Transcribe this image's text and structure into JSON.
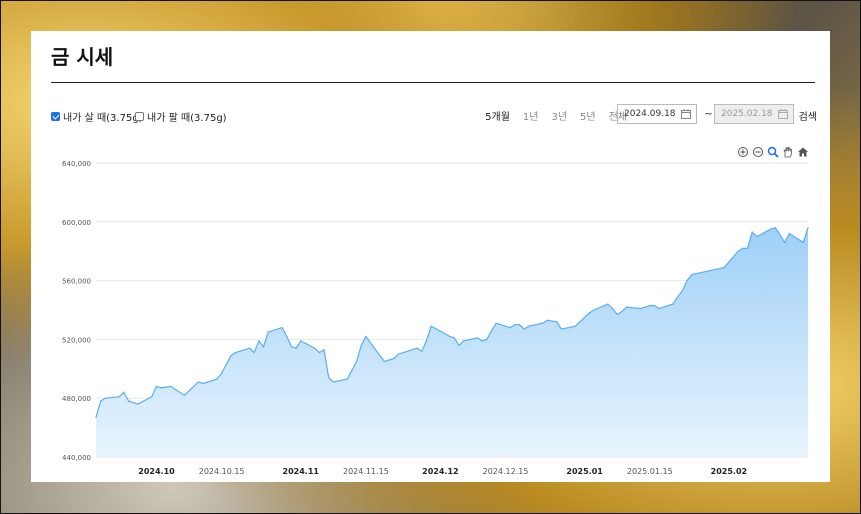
{
  "page": {
    "title": "금 시세"
  },
  "toolbar": {
    "buy_label": "내가 살 때(3.75g)",
    "buy_checked": true,
    "sell_label": "내가 팔 때(3.75g)",
    "sell_checked": false,
    "periods": [
      {
        "label": "5개월",
        "active": true
      },
      {
        "label": "1년",
        "active": false
      },
      {
        "label": "3년",
        "active": false
      },
      {
        "label": "5년",
        "active": false
      },
      {
        "label": "전체",
        "active": false
      }
    ],
    "start_date": "2024.09.18",
    "end_date": "2025.02.18",
    "separator": "~",
    "search_label": "검색"
  },
  "chart_tools": [
    "zoom-in-icon",
    "zoom-out-icon",
    "magnify-icon",
    "pan-hand-icon",
    "home-icon"
  ],
  "colors": {
    "area_fill_top": "#9fd0f7",
    "area_fill_bottom": "#e8f4fd",
    "line": "#5aaef0",
    "accent": "#1a73e8"
  },
  "chart_data": {
    "type": "area",
    "title": "",
    "xlabel": "",
    "ylabel": "",
    "ylim": [
      440000,
      640000
    ],
    "y_ticks": [
      "440,000",
      "480,000",
      "520,000",
      "560,000",
      "600,000",
      "640,000"
    ],
    "y_tick_values": [
      440000,
      480000,
      520000,
      560000,
      600000,
      640000
    ],
    "x_ticks": [
      {
        "label": "2024.10",
        "bold": true,
        "date": "2024-10-01"
      },
      {
        "label": "2024.10.15",
        "bold": false,
        "date": "2024-10-15"
      },
      {
        "label": "2024.11",
        "bold": true,
        "date": "2024-11-01"
      },
      {
        "label": "2024.11.15",
        "bold": false,
        "date": "2024-11-15"
      },
      {
        "label": "2024.12",
        "bold": true,
        "date": "2024-12-01"
      },
      {
        "label": "2024.12.15",
        "bold": false,
        "date": "2024-12-15"
      },
      {
        "label": "2025.01",
        "bold": true,
        "date": "2025-01-01"
      },
      {
        "label": "2025.01.15",
        "bold": false,
        "date": "2025-01-15"
      },
      {
        "label": "2025.02",
        "bold": true,
        "date": "2025-02-01"
      }
    ],
    "grid": true,
    "legend": "none",
    "series": [
      {
        "x": [
          "2024-09-18",
          "2024-09-19",
          "2024-09-20",
          "2024-09-23",
          "2024-09-24",
          "2024-09-25",
          "2024-09-26",
          "2024-09-27",
          "2024-09-30",
          "2024-10-01",
          "2024-10-02",
          "2024-10-04",
          "2024-10-07",
          "2024-10-08",
          "2024-10-10",
          "2024-10-11",
          "2024-10-14",
          "2024-10-15",
          "2024-10-16",
          "2024-10-17",
          "2024-10-18",
          "2024-10-21",
          "2024-10-22",
          "2024-10-23",
          "2024-10-24",
          "2024-10-25",
          "2024-10-28",
          "2024-10-29",
          "2024-10-30",
          "2024-10-31",
          "2024-11-01",
          "2024-11-04",
          "2024-11-05",
          "2024-11-06",
          "2024-11-07",
          "2024-11-08",
          "2024-11-11",
          "2024-11-12",
          "2024-11-13",
          "2024-11-14",
          "2024-11-15",
          "2024-11-18",
          "2024-11-19",
          "2024-11-20",
          "2024-11-21",
          "2024-11-22",
          "2024-11-25",
          "2024-11-26",
          "2024-11-27",
          "2024-11-28",
          "2024-11-29",
          "2024-12-02",
          "2024-12-03",
          "2024-12-04",
          "2024-12-05",
          "2024-12-06",
          "2024-12-09",
          "2024-12-10",
          "2024-12-11",
          "2024-12-12",
          "2024-12-13",
          "2024-12-16",
          "2024-12-17",
          "2024-12-18",
          "2024-12-19",
          "2024-12-20",
          "2024-12-23",
          "2024-12-24",
          "2024-12-26",
          "2024-12-27",
          "2024-12-30",
          "2025-01-02",
          "2025-01-03",
          "2025-01-06",
          "2025-01-07",
          "2025-01-08",
          "2025-01-09",
          "2025-01-10",
          "2025-01-13",
          "2025-01-14",
          "2025-01-15",
          "2025-01-16",
          "2025-01-17",
          "2025-01-20",
          "2025-01-21",
          "2025-01-22",
          "2025-01-23",
          "2025-01-24",
          "2025-01-31",
          "2025-02-03",
          "2025-02-04",
          "2025-02-05",
          "2025-02-06",
          "2025-02-07",
          "2025-02-10",
          "2025-02-11",
          "2025-02-12",
          "2025-02-13",
          "2025-02-14",
          "2025-02-17",
          "2025-02-18"
        ],
        "y": [
          467000,
          478000,
          480000,
          481000,
          484000,
          478000,
          477000,
          476000,
          481000,
          488000,
          487000,
          488000,
          482000,
          485000,
          491000,
          490000,
          493000,
          497000,
          503000,
          509000,
          511000,
          514000,
          511000,
          519000,
          515000,
          525000,
          528000,
          522000,
          515000,
          514000,
          519000,
          514000,
          511000,
          513000,
          494000,
          491000,
          493000,
          499000,
          505000,
          516000,
          522000,
          509000,
          505000,
          506000,
          507000,
          510000,
          513000,
          514000,
          512000,
          519000,
          529000,
          524000,
          522000,
          521000,
          516000,
          519000,
          521000,
          519000,
          520000,
          526000,
          531000,
          528000,
          530000,
          530000,
          527000,
          529000,
          531000,
          533000,
          532000,
          527000,
          529000,
          538000,
          540000,
          544000,
          541000,
          537000,
          539000,
          542000,
          541000,
          542000,
          543000,
          543000,
          541000,
          544000,
          549000,
          553000,
          560000,
          564000,
          569000,
          580000,
          582000,
          582000,
          593000,
          590000,
          595000,
          596000,
          591000,
          586000,
          592000,
          586000,
          596000
        ]
      }
    ]
  }
}
